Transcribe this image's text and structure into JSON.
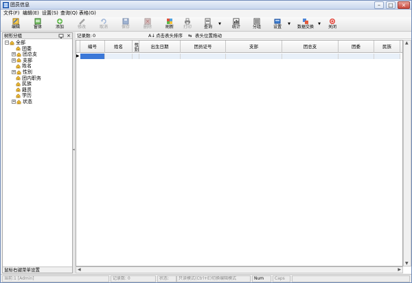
{
  "window": {
    "title": "团员信息",
    "controls": {
      "minimize": "–",
      "maximize": "□",
      "close": "×"
    }
  },
  "menu": [
    "文件(F)",
    "编辑(E)",
    "设置(S)",
    "查询(Q)",
    "表格(G)"
  ],
  "toolbar": {
    "items": [
      {
        "label": "编辑",
        "icon": "edit-icon",
        "enabled": true
      },
      {
        "label": "窗体",
        "icon": "form-icon",
        "enabled": true
      },
      {
        "label": "添加",
        "icon": "add-icon",
        "enabled": true
      },
      {
        "label": "修改",
        "icon": "modify-icon",
        "enabled": false
      },
      {
        "label": "取消",
        "icon": "cancel-icon",
        "enabled": false
      },
      {
        "label": "保存",
        "icon": "save-icon",
        "enabled": false
      },
      {
        "label": "删除",
        "icon": "delete-icon",
        "enabled": false
      },
      {
        "label": "刷新",
        "icon": "refresh-icon",
        "enabled": true
      },
      {
        "label": "打印",
        "icon": "print-icon",
        "enabled": false
      },
      {
        "label": "查询",
        "icon": "query-icon",
        "enabled": true
      },
      {
        "label": "统计",
        "icon": "stats-icon",
        "enabled": true
      },
      {
        "label": "分组",
        "icon": "group-icon",
        "enabled": true
      },
      {
        "label": "设置",
        "icon": "settings-icon",
        "enabled": true
      },
      {
        "label": "数据交换",
        "icon": "data-exchange-icon",
        "enabled": true
      },
      {
        "label": "关闭",
        "icon": "close-icon",
        "enabled": true
      }
    ]
  },
  "left_panel": {
    "title": "树形分组",
    "close_glyph": "×",
    "tree": [
      {
        "label": "全部",
        "level": 0,
        "expander": "−"
      },
      {
        "label": "团委",
        "level": 1,
        "expander": ""
      },
      {
        "label": "团总支",
        "level": 1,
        "expander": "+"
      },
      {
        "label": "支部",
        "level": 1,
        "expander": "+"
      },
      {
        "label": "姓名",
        "level": 1,
        "expander": ""
      },
      {
        "label": "性别",
        "level": 1,
        "expander": "+"
      },
      {
        "label": "团内职务",
        "level": 1,
        "expander": ""
      },
      {
        "label": "民族",
        "level": 1,
        "expander": ""
      },
      {
        "label": "籍贯",
        "level": 1,
        "expander": ""
      },
      {
        "label": "学历",
        "level": 1,
        "expander": ""
      },
      {
        "label": "状态",
        "level": 1,
        "expander": "+"
      }
    ],
    "footer": "鼠标右键菜单设置"
  },
  "info_bar": {
    "record_count_label": "记录数:",
    "record_count": "0",
    "sort_hint": "点击表头排序",
    "drag_hint": "表头位置拖动"
  },
  "table": {
    "columns": [
      "编号",
      "姓名",
      "性别",
      "出生日期",
      "团员证号",
      "支部",
      "团总支",
      "团委",
      "民族"
    ],
    "rows": []
  },
  "status_bar": {
    "fields": [
      "当前:1 [Admin]",
      "记录数: 0",
      "状态:",
      "只读模式(Ctrl+E)切换编辑模式",
      "Num",
      "Caps",
      ""
    ]
  },
  "colors": {
    "selection": "#3b78d8",
    "title_bar": "#c9d7ee",
    "row_tint": "#e8f0f9"
  }
}
